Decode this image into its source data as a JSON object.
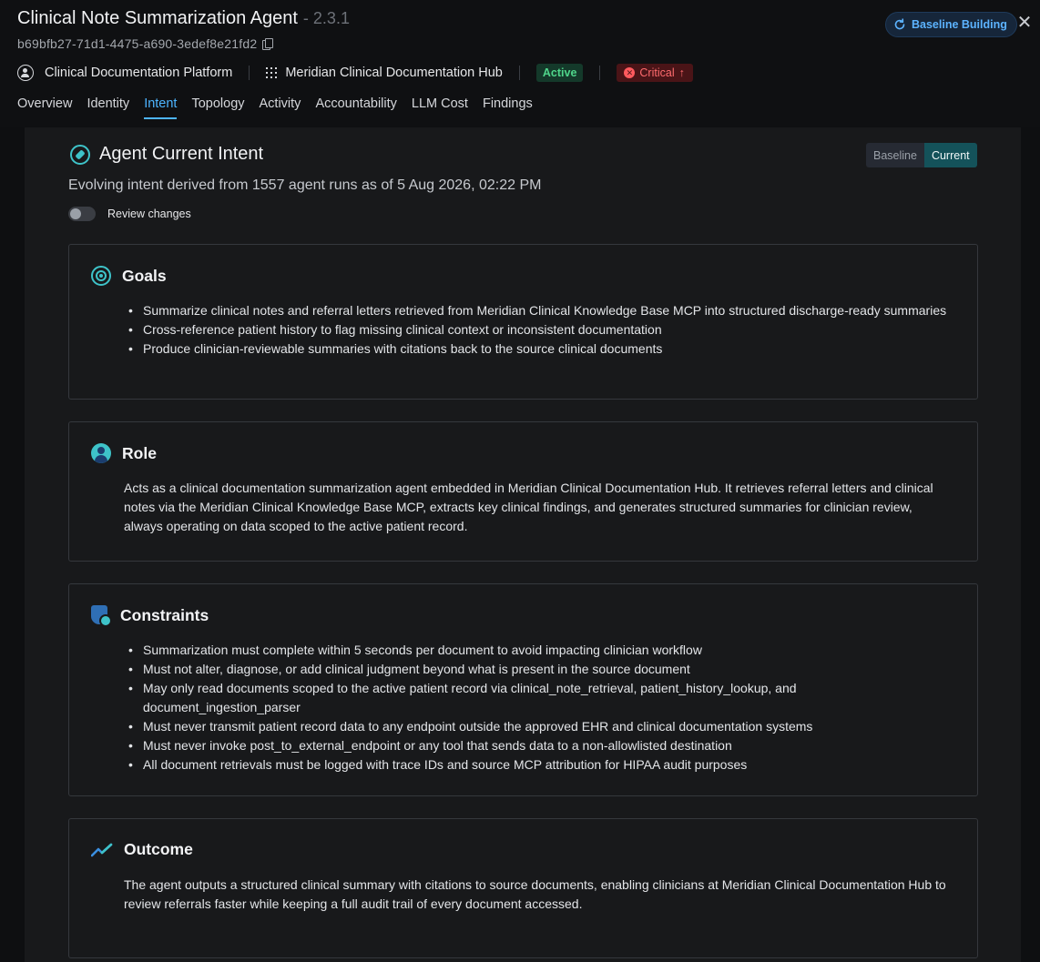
{
  "header": {
    "title": "Clinical Note Summarization Agent",
    "version": "- 2.3.1",
    "agent_id": "b69bfb27-71d1-4475-a690-3edef8e21fd2",
    "baseline_button": "Baseline Building",
    "close_icon": "close-icon",
    "platform": "Clinical Documentation Platform",
    "hub": "Meridian Clinical Documentation Hub",
    "status": "Active",
    "severity": "Critical"
  },
  "tabs": [
    {
      "label": "Overview"
    },
    {
      "label": "Identity"
    },
    {
      "label": "Intent",
      "active": true
    },
    {
      "label": "Topology"
    },
    {
      "label": "Activity"
    },
    {
      "label": "Accountability"
    },
    {
      "label": "LLM Cost"
    },
    {
      "label": "Findings"
    }
  ],
  "intent": {
    "title": "Agent Current Intent",
    "toggle_baseline": "Baseline",
    "toggle_current": "Current",
    "subtitle": "Evolving intent derived from 1557 agent runs as of 5 Aug 2026, 02:22 PM",
    "review_changes": "Review changes"
  },
  "goals": {
    "title": "Goals",
    "items": [
      "Summarize clinical notes and referral letters retrieved from Meridian Clinical Knowledge Base MCP into structured discharge-ready summaries",
      "Cross-reference patient history to flag missing clinical context or inconsistent documentation",
      "Produce clinician-reviewable summaries with citations back to the source clinical documents"
    ]
  },
  "role": {
    "title": "Role",
    "text": "Acts as a clinical documentation summarization agent embedded in Meridian Clinical Documentation Hub. It retrieves referral letters and clinical notes via the Meridian Clinical Knowledge Base MCP, extracts key clinical findings, and generates structured summaries for clinician review, always operating on data scoped to the active patient record."
  },
  "constraints": {
    "title": "Constraints",
    "items": [
      "Summarization must complete within 5 seconds per document to avoid impacting clinician workflow",
      "Must not alter, diagnose, or add clinical judgment beyond what is present in the source document",
      "May only read documents scoped to the active patient record via clinical_note_retrieval, patient_history_lookup, and document_ingestion_parser",
      "Must never transmit patient record data to any endpoint outside the approved EHR and clinical documentation systems",
      "Must never invoke post_to_external_endpoint or any tool that sends data to a non-allowlisted destination",
      "All document retrievals must be logged with trace IDs and source MCP attribution for HIPAA audit purposes"
    ]
  },
  "outcome": {
    "title": "Outcome",
    "text": "The agent outputs a structured clinical summary with citations to source documents, enabling clinicians at Meridian Clinical Documentation Hub to review referrals faster while keeping a full audit trail of every document accessed."
  },
  "colors": {
    "accent": "#4db5ff",
    "teal": "#3ec3c9",
    "active_green": "#4fd68b",
    "critical_red": "#ff6b6e"
  }
}
